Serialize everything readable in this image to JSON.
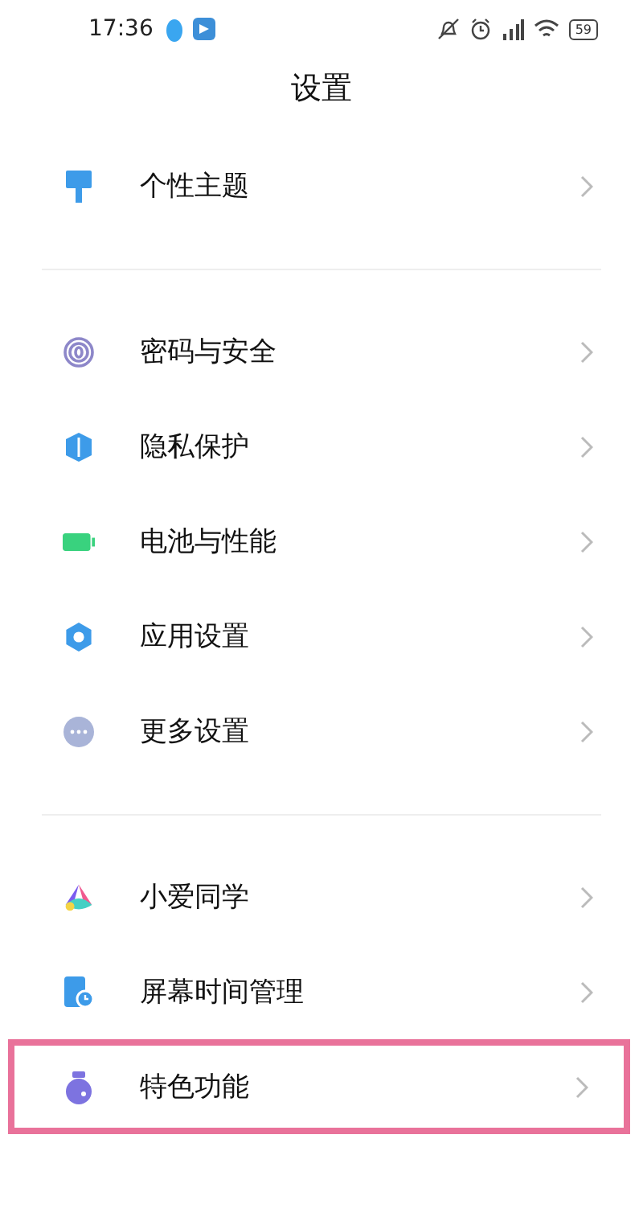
{
  "status_bar": {
    "time": "17:36",
    "battery": "59"
  },
  "title": "设置",
  "sections": [
    {
      "items": [
        {
          "label": "个性主题",
          "highlighted": false
        }
      ]
    },
    {
      "items": [
        {
          "label": "密码与安全",
          "highlighted": false
        },
        {
          "label": "隐私保护",
          "highlighted": false
        },
        {
          "label": "电池与性能",
          "highlighted": false
        },
        {
          "label": "应用设置",
          "highlighted": false
        },
        {
          "label": "更多设置",
          "highlighted": false
        }
      ]
    },
    {
      "items": [
        {
          "label": "小爱同学",
          "highlighted": false
        },
        {
          "label": "屏幕时间管理",
          "highlighted": false
        },
        {
          "label": "特色功能",
          "highlighted": true
        }
      ]
    }
  ]
}
